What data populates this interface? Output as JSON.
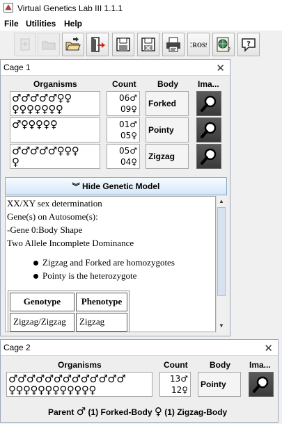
{
  "window": {
    "title": "Virtual Genetics Lab III 1.1.1"
  },
  "menu": {
    "items": [
      "File",
      "Utilities",
      "Help"
    ]
  },
  "toolbar": {
    "buttons": [
      {
        "name": "new-problem-button",
        "icon": "sparkle-doc-icon",
        "enabled": false
      },
      {
        "name": "open-folder-button",
        "icon": "folder-icon",
        "enabled": false
      },
      {
        "name": "open-work-button",
        "icon": "open-folder-arrow-icon",
        "enabled": true
      },
      {
        "name": "close-work-button",
        "icon": "exit-door-icon",
        "enabled": true
      },
      {
        "name": "save-button",
        "icon": "floppy-disk-icon",
        "enabled": true
      },
      {
        "name": "save-as-button",
        "icon": "floppy-disk-x-icon",
        "enabled": true
      },
      {
        "name": "print-button",
        "icon": "printer-icon",
        "enabled": true
      },
      {
        "name": "cross-button",
        "icon": "cross-icon",
        "label": "CROSS",
        "enabled": true
      },
      {
        "name": "summary-button",
        "icon": "globe-doc-icon",
        "enabled": true
      },
      {
        "name": "help-button",
        "icon": "speech-bubble-icon",
        "enabled": true
      }
    ]
  },
  "cage1": {
    "title": "Cage 1",
    "headers": {
      "organisms": "Organisms",
      "count": "Count",
      "body": "Body",
      "image": "Ima..."
    },
    "rows": [
      {
        "organisms_line1": "♂♂♂♂♂♀♀",
        "organisms_line2": "♀♀♀♀♀♀♀",
        "male_count": "06♂",
        "female_count": "09♀",
        "phenotype": "Forked"
      },
      {
        "organisms_line1": "♂♀♀♀♀♀",
        "organisms_line2": "",
        "male_count": "01♂",
        "female_count": "05♀",
        "phenotype": "Pointy"
      },
      {
        "organisms_line1": "♂♂♂♂♂♀♀♀",
        "organisms_line2": "♀",
        "male_count": "05♂",
        "female_count": "04♀",
        "phenotype": "Zigzag"
      }
    ],
    "hide_model_label": "Hide Genetic Model",
    "model": {
      "lines": [
        "XX/XY sex determination",
        "Gene(s) on Autosome(s):",
        "-Gene 0:Body Shape",
        "Two Allele Incomplete Dominance"
      ],
      "bullets": [
        "Zigzag and Forked are homozygotes",
        "Pointy is the heterozygote"
      ],
      "table": {
        "headers": [
          "Genotype",
          "Phenotype"
        ],
        "rows": [
          [
            "Zigzag/Zigzag",
            "Zigzag"
          ]
        ]
      }
    }
  },
  "cage2": {
    "title": "Cage 2",
    "headers": {
      "organisms": "Organisms",
      "count": "Count",
      "body": "Body",
      "image": "Ima..."
    },
    "rows": [
      {
        "organisms_line1": "♂♂♂♂♂♂♂♂♂♂♂♂♂",
        "organisms_line2": "♀♀♀♀♀♀♀♀♀♀♀♀",
        "male_count": "13♂",
        "female_count": "12♀",
        "phenotype": "Pointy"
      }
    ],
    "parent": {
      "label": "Parent",
      "male_symbol": "♂",
      "male_text": "(1) Forked-Body",
      "female_symbol": "♀",
      "female_text": "(1) Zigzag-Body"
    }
  }
}
